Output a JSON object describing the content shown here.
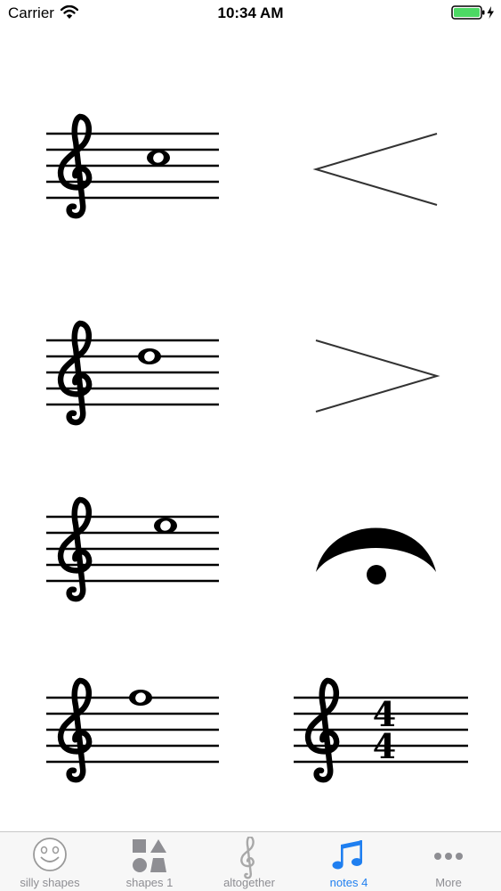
{
  "status_bar": {
    "carrier": "Carrier",
    "time": "10:34 AM",
    "icons": [
      "wifi-icon",
      "battery-icon",
      "charging-bolt-icon"
    ]
  },
  "grid": {
    "cells": [
      {
        "name": "treble-staff-note-c5",
        "icon": "treble-clef-staff-whole-note"
      },
      {
        "name": "crescendo-hairpin",
        "icon": "crescendo-icon"
      },
      {
        "name": "treble-staff-note-d5",
        "icon": "treble-clef-staff-whole-note"
      },
      {
        "name": "decrescendo-hairpin",
        "icon": "decrescendo-icon"
      },
      {
        "name": "treble-staff-note-e5",
        "icon": "treble-clef-staff-whole-note"
      },
      {
        "name": "fermata",
        "icon": "fermata-icon"
      },
      {
        "name": "treble-staff-note-f5",
        "icon": "treble-clef-staff-whole-note"
      },
      {
        "name": "time-signature-4-4",
        "icon": "time-signature-icon"
      }
    ],
    "time_signature": {
      "top": "4",
      "bottom": "4"
    }
  },
  "tab_bar": {
    "accent_color": "#1f7ff0",
    "inactive_color": "#8e8e93",
    "selected": "notes 4",
    "tabs": [
      {
        "label": "silly shapes",
        "icon": "smiley-face-icon"
      },
      {
        "label": "shapes 1",
        "icon": "shapes-icon"
      },
      {
        "label": "altogether",
        "icon": "treble-clef-icon"
      },
      {
        "label": "notes 4",
        "icon": "music-notes-icon"
      },
      {
        "label": "More",
        "icon": "more-dots-icon"
      }
    ]
  }
}
